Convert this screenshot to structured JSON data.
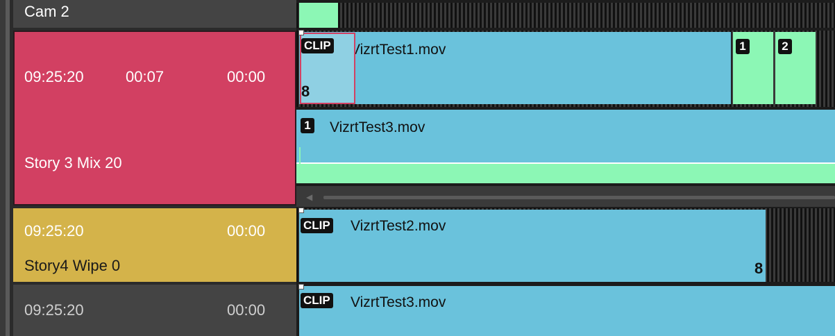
{
  "stories": [
    {
      "label": "Cam 2"
    },
    {
      "time": "09:25:20",
      "duration": "00:07",
      "offset": "00:00",
      "label": "Story 3 Mix 20",
      "color": "#d24062"
    },
    {
      "time": "09:25:20",
      "offset": "00:00",
      "label": "Story4 Wipe 0",
      "color": "#d4b34a"
    },
    {
      "time": "09:25:20",
      "offset": "00:00"
    }
  ],
  "timeline": {
    "clip_badge": "CLIP",
    "loop_icon": "loop-icon",
    "clips": [
      {
        "name": "VizrtTest1.mov"
      },
      {
        "name": "VizrtTest3.mov",
        "badge": "1"
      },
      {
        "name": "VizrtTest2.mov"
      },
      {
        "name": "VizrtTest3.mov"
      }
    ],
    "markers": [
      "1",
      "2"
    ]
  },
  "colors": {
    "clip": "#6ac2dc",
    "green": "#8cf7b5",
    "selected_story": "#d24062",
    "story4": "#d4b34a"
  }
}
